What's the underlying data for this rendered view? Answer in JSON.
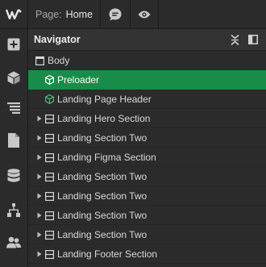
{
  "rail": {
    "logo": "W",
    "icons": [
      "add-icon",
      "cube-icon",
      "align-lines-icon",
      "page-icon",
      "database-icon",
      "sitemap-icon",
      "users-icon"
    ]
  },
  "topbar": {
    "page_label": "Page:",
    "page_value": "Home",
    "icons": [
      "comment-icon",
      "eye-icon"
    ]
  },
  "navigator": {
    "title": "Navigator",
    "items": [
      {
        "label": "Body",
        "icon": "body-icon",
        "level": 0,
        "caret": false,
        "selected": false
      },
      {
        "label": "Preloader",
        "icon": "component-icon",
        "level": 1,
        "caret": false,
        "selected": true
      },
      {
        "label": "Landing Page Header",
        "icon": "component-icon",
        "level": 1,
        "caret": false,
        "selected": false
      },
      {
        "label": "Landing Hero Section",
        "icon": "section-icon",
        "level": 1,
        "caret": true,
        "selected": false
      },
      {
        "label": "Landing Section Two",
        "icon": "section-icon",
        "level": 1,
        "caret": true,
        "selected": false
      },
      {
        "label": "Landing Figma Section",
        "icon": "section-icon",
        "level": 1,
        "caret": true,
        "selected": false
      },
      {
        "label": "Landing Section Two",
        "icon": "section-icon",
        "level": 1,
        "caret": true,
        "selected": false
      },
      {
        "label": "Landing Section Two",
        "icon": "section-icon",
        "level": 1,
        "caret": true,
        "selected": false
      },
      {
        "label": "Landing Section Two",
        "icon": "section-icon",
        "level": 1,
        "caret": true,
        "selected": false
      },
      {
        "label": "Landing Section Two",
        "icon": "section-icon",
        "level": 1,
        "caret": true,
        "selected": false
      },
      {
        "label": "Landing Footer Section",
        "icon": "section-icon",
        "level": 1,
        "caret": true,
        "selected": false
      }
    ]
  },
  "colors": {
    "background": "#2b2b2b",
    "header": "#333333",
    "selected": "#1a8c49",
    "component_icon": "#3cc27a",
    "text": "#d9d9d9"
  }
}
